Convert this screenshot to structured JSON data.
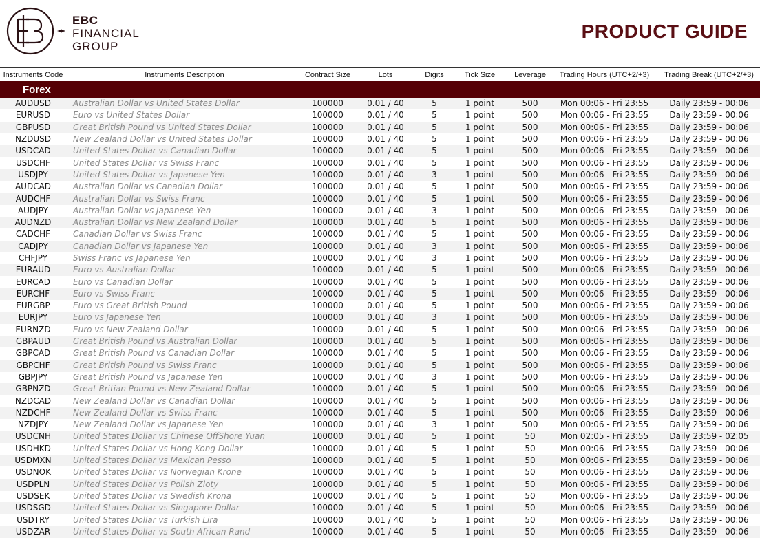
{
  "brand": {
    "line1": "EBC",
    "line2": "FINANCIAL",
    "line3": "GROUP"
  },
  "title": "PRODUCT GUIDE",
  "columns": [
    "Instruments Code",
    "Instruments Description",
    "Contract Size",
    "Lots",
    "Digits",
    "Tick Size",
    "Leverage",
    "Trading Hours (UTC+2/+3)",
    "Trading Break  (UTC+2/+3)"
  ],
  "section": "Forex",
  "rows": [
    [
      "AUDUSD",
      "Australian Dollar vs United States Dollar",
      "100000",
      "0.01 / 40",
      "5",
      "1 point",
      "500",
      "Mon 00:06 - Fri 23:55",
      "Daily 23:59 - 00:06"
    ],
    [
      "EURUSD",
      "Euro vs United States Dollar",
      "100000",
      "0.01 / 40",
      "5",
      "1 point",
      "500",
      "Mon 00:06 - Fri 23:55",
      "Daily 23:59 - 00:06"
    ],
    [
      "GBPUSD",
      "Great British Pound vs United States Dollar",
      "100000",
      "0.01 / 40",
      "5",
      "1 point",
      "500",
      "Mon 00:06 - Fri 23:55",
      "Daily 23:59 - 00:06"
    ],
    [
      "NZDUSD",
      "New Zealand Dollar vs United States Dollar",
      "100000",
      "0.01 / 40",
      "5",
      "1 point",
      "500",
      "Mon 00:06 - Fri 23:55",
      "Daily 23:59 - 00:06"
    ],
    [
      "USDCAD",
      "United States Dollar vs Canadian Dollar",
      "100000",
      "0.01 / 40",
      "5",
      "1 point",
      "500",
      "Mon 00:06 - Fri 23:55",
      "Daily 23:59 - 00:06"
    ],
    [
      "USDCHF",
      "United States Dollar vs Swiss Franc",
      "100000",
      "0.01 / 40",
      "5",
      "1 point",
      "500",
      "Mon 00:06 - Fri 23:55",
      "Daily 23:59 - 00:06"
    ],
    [
      "USDJPY",
      "United States Dollar vs Japanese Yen",
      "100000",
      "0.01 / 40",
      "3",
      "1 point",
      "500",
      "Mon 00:06 - Fri 23:55",
      "Daily 23:59 - 00:06"
    ],
    [
      "AUDCAD",
      "Australian Dollar vs Canadian Dollar",
      "100000",
      "0.01 / 40",
      "5",
      "1 point",
      "500",
      "Mon 00:06 - Fri 23:55",
      "Daily 23:59 - 00:06"
    ],
    [
      "AUDCHF",
      "Australian Dollar vs Swiss Franc",
      "100000",
      "0.01 / 40",
      "5",
      "1 point",
      "500",
      "Mon 00:06 - Fri 23:55",
      "Daily 23:59 - 00:06"
    ],
    [
      "AUDJPY",
      "Australian Dollar vs Japanese Yen",
      "100000",
      "0.01 / 40",
      "3",
      "1 point",
      "500",
      "Mon 00:06 - Fri 23:55",
      "Daily 23:59 - 00:06"
    ],
    [
      "AUDNZD",
      "Australian Dollar vs New Zealand Dollar",
      "100000",
      "0.01 / 40",
      "5",
      "1 point",
      "500",
      "Mon 00:06 - Fri 23:55",
      "Daily 23:59 - 00:06"
    ],
    [
      "CADCHF",
      "Canadian Dollar vs Swiss Franc",
      "100000",
      "0.01 / 40",
      "5",
      "1 point",
      "500",
      "Mon 00:06 - Fri 23:55",
      "Daily 23:59 - 00:06"
    ],
    [
      "CADJPY",
      "Canadian Dollar vs Japanese Yen",
      "100000",
      "0.01 / 40",
      "3",
      "1 point",
      "500",
      "Mon 00:06 - Fri 23:55",
      "Daily 23:59 - 00:06"
    ],
    [
      "CHFJPY",
      "Swiss Franc vs Japanese Yen",
      "100000",
      "0.01 / 40",
      "3",
      "1 point",
      "500",
      "Mon 00:06 - Fri 23:55",
      "Daily 23:59 - 00:06"
    ],
    [
      "EURAUD",
      "Euro vs Australian Dollar",
      "100000",
      "0.01 / 40",
      "5",
      "1 point",
      "500",
      "Mon 00:06 - Fri 23:55",
      "Daily 23:59 - 00:06"
    ],
    [
      "EURCAD",
      "Euro vs Canadian Dollar",
      "100000",
      "0.01 / 40",
      "5",
      "1 point",
      "500",
      "Mon 00:06 - Fri 23:55",
      "Daily 23:59 - 00:06"
    ],
    [
      "EURCHF",
      "Euro vs Swiss Franc",
      "100000",
      "0.01 / 40",
      "5",
      "1 point",
      "500",
      "Mon 00:06 - Fri 23:55",
      "Daily 23:59 - 00:06"
    ],
    [
      "EURGBP",
      "Euro vs Great British Pound",
      "100000",
      "0.01 / 40",
      "5",
      "1 point",
      "500",
      "Mon 00:06 - Fri 23:55",
      "Daily 23:59 - 00:06"
    ],
    [
      "EURJPY",
      "Euro vs Japanese Yen",
      "100000",
      "0.01 / 40",
      "3",
      "1 point",
      "500",
      "Mon 00:06 - Fri 23:55",
      "Daily 23:59 - 00:06"
    ],
    [
      "EURNZD",
      "Euro vs New Zealand Dollar",
      "100000",
      "0.01 / 40",
      "5",
      "1 point",
      "500",
      "Mon 00:06 - Fri 23:55",
      "Daily 23:59 - 00:06"
    ],
    [
      "GBPAUD",
      "Great British Pound vs Australian Dollar",
      "100000",
      "0.01 / 40",
      "5",
      "1 point",
      "500",
      "Mon 00:06 - Fri 23:55",
      "Daily 23:59 - 00:06"
    ],
    [
      "GBPCAD",
      "Great British Pound vs Canadian Dollar",
      "100000",
      "0.01 / 40",
      "5",
      "1 point",
      "500",
      "Mon 00:06 - Fri 23:55",
      "Daily 23:59 - 00:06"
    ],
    [
      "GBPCHF",
      "Great British Pound vs Swiss Franc",
      "100000",
      "0.01 / 40",
      "5",
      "1 point",
      "500",
      "Mon 00:06 - Fri 23:55",
      "Daily 23:59 - 00:06"
    ],
    [
      "GBPJPY",
      "Great British Pound vs Japanese Yen",
      "100000",
      "0.01 / 40",
      "3",
      "1 point",
      "500",
      "Mon 00:06 - Fri 23:55",
      "Daily 23:59 - 00:06"
    ],
    [
      "GBPNZD",
      "Great Britian Pound vs New Zealand Dollar",
      "100000",
      "0.01 / 40",
      "5",
      "1 point",
      "500",
      "Mon 00:06 - Fri 23:55",
      "Daily 23:59 - 00:06"
    ],
    [
      "NZDCAD",
      "New Zealand Dollar vs Canadian Dollar",
      "100000",
      "0.01 / 40",
      "5",
      "1 point",
      "500",
      "Mon 00:06 - Fri 23:55",
      "Daily 23:59 - 00:06"
    ],
    [
      "NZDCHF",
      "New Zealand Dollar vs Swiss Franc",
      "100000",
      "0.01 / 40",
      "5",
      "1 point",
      "500",
      "Mon 00:06 - Fri 23:55",
      "Daily 23:59 - 00:06"
    ],
    [
      "NZDJPY",
      "New Zealand Dollar vs Japanese Yen",
      "100000",
      "0.01 / 40",
      "3",
      "1 point",
      "500",
      "Mon 00:06 - Fri 23:55",
      "Daily 23:59 - 00:06"
    ],
    [
      "USDCNH",
      "United States Dollar vs Chinese OffShore Yuan",
      "100000",
      "0.01 / 40",
      "5",
      "1 point",
      "50",
      "Mon 02:05 - Fri 23:55",
      "Daily 23:59 - 02:05"
    ],
    [
      "USDHKD",
      "United States Dollar vs Hong Kong Dollar",
      "100000",
      "0.01 / 40",
      "5",
      "1 point",
      "50",
      "Mon 00:06 - Fri 23:55",
      "Daily 23:59 - 00:06"
    ],
    [
      "USDMXN",
      "United States Dollar vs Mexican Pesso",
      "100000",
      "0.01 / 40",
      "5",
      "1 point",
      "50",
      "Mon 00:06 - Fri 23:55",
      "Daily 23:59 - 00:06"
    ],
    [
      "USDNOK",
      "United States Dollar vs Norwegian Krone",
      "100000",
      "0.01 / 40",
      "5",
      "1 point",
      "50",
      "Mon 00:06 - Fri 23:55",
      "Daily 23:59 - 00:06"
    ],
    [
      "USDPLN",
      "United States Dollar vs Polish Zloty",
      "100000",
      "0.01 / 40",
      "5",
      "1 point",
      "50",
      "Mon 00:06 - Fri 23:55",
      "Daily 23:59 - 00:06"
    ],
    [
      "USDSEK",
      "United States Dollar vs Swedish Krona",
      "100000",
      "0.01 / 40",
      "5",
      "1 point",
      "50",
      "Mon 00:06 - Fri 23:55",
      "Daily 23:59 - 00:06"
    ],
    [
      "USDSGD",
      "United States Dollar vs Singapore Dollar",
      "100000",
      "0.01 / 40",
      "5",
      "1 point",
      "50",
      "Mon 00:06 - Fri 23:55",
      "Daily 23:59 - 00:06"
    ],
    [
      "USDTRY",
      "United States Dollar vs Turkish Lira",
      "100000",
      "0.01 / 40",
      "5",
      "1 point",
      "50",
      "Mon 00:06 - Fri 23:55",
      "Daily 23:59 - 00:06"
    ],
    [
      "USDZAR",
      "United States Dollar vs South African Rand",
      "100000",
      "0.01 / 40",
      "5",
      "1 point",
      "50",
      "Mon 00:06 - Fri 23:55",
      "Daily 23:59 - 00:06"
    ]
  ],
  "colors": {
    "brand": "#5a0f14",
    "section_bg": "#550005",
    "stripe": "#f2f2f2",
    "desc_text": "#8a8a8a"
  }
}
